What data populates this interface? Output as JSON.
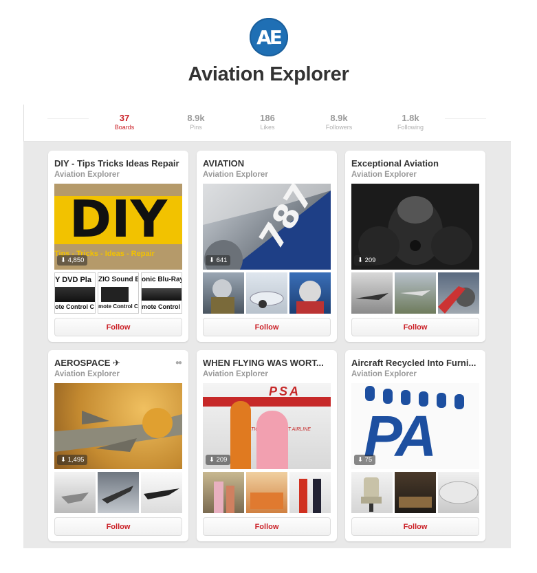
{
  "profile": {
    "logo_text": "AE",
    "name": "Aviation Explorer"
  },
  "stats": [
    {
      "value": "37",
      "label": "Boards",
      "active": true
    },
    {
      "value": "8.9k",
      "label": "Pins",
      "active": false
    },
    {
      "value": "186",
      "label": "Likes",
      "active": false
    },
    {
      "value": "8.9k",
      "label": "Followers",
      "active": false
    },
    {
      "value": "1.8k",
      "label": "Following",
      "active": false
    }
  ],
  "boards": [
    {
      "title": "DIY - Tips Tricks Ideas Repair",
      "owner": "Aviation Explorer",
      "pin_count": "4,850",
      "cover_text": "DIY",
      "cover_subtext": "Tips - Tricks - Ideas - Repair",
      "thumb_texts": [
        "Y DVD Pla",
        "ZIO Sound B",
        "onic Blu-Ray I"
      ],
      "thumb_subtexts": [
        "ote Control C",
        "mote Control Co",
        "mote Control"
      ],
      "follow_label": "Follow"
    },
    {
      "title": "AVIATION",
      "owner": "Aviation Explorer",
      "pin_count": "641",
      "cover_text": "787",
      "follow_label": "Follow"
    },
    {
      "title": "Exceptional Aviation",
      "owner": "Aviation Explorer",
      "pin_count": "209",
      "follow_label": "Follow"
    },
    {
      "title": "AEROSPACE ✈",
      "owner": "Aviation Explorer",
      "pin_count": "1,495",
      "follow_label": "Follow",
      "collaborative": true
    },
    {
      "title": "WHEN FLYING WAS WORT...",
      "owner": "Aviation Explorer",
      "pin_count": "209",
      "cover_text": "PSA",
      "cover_subtext": "TIC SOUTHWEST AIRLINE",
      "follow_label": "Follow"
    },
    {
      "title": "Aircraft Recycled Into Furni...",
      "owner": "Aviation Explorer",
      "pin_count": "75",
      "cover_text": "PA",
      "follow_label": "Follow"
    }
  ],
  "icons": {
    "pin": "pin-icon",
    "collab": "collaborators-icon"
  },
  "colors": {
    "accent": "#cb2027",
    "logo_blue": "#1f6fb4"
  }
}
